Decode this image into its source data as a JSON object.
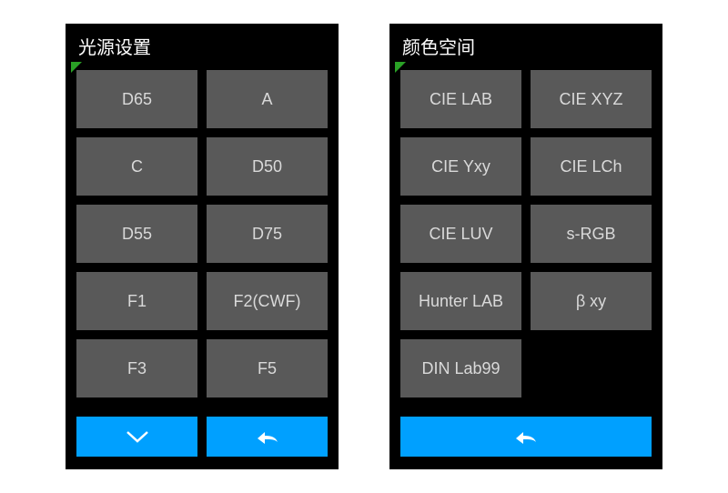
{
  "panels": [
    {
      "title": "光源设置",
      "options": [
        "D65",
        "A",
        "C",
        "D50",
        "D55",
        "D75",
        "F1",
        "F2(CWF)",
        "F3",
        "F5"
      ],
      "bottom": [
        "down",
        "back"
      ]
    },
    {
      "title": "颜色空间",
      "options": [
        "CIE LAB",
        "CIE XYZ",
        "CIE Yxy",
        "CIE LCh",
        "CIE LUV",
        "s-RGB",
        "Hunter LAB",
        "β xy",
        "DIN Lab99"
      ],
      "bottom": [
        "back-full"
      ]
    }
  ],
  "colors": {
    "accent": "#00a0ff",
    "button": "#595959",
    "indicator": "#2aa126"
  }
}
